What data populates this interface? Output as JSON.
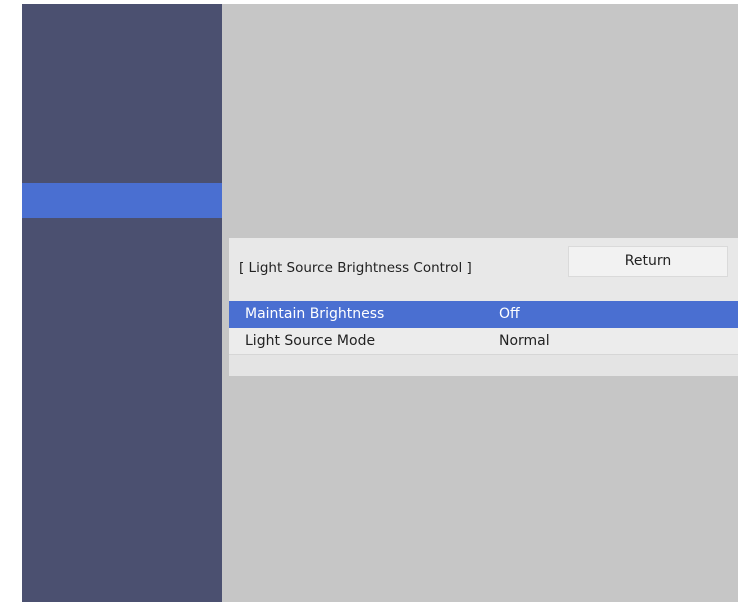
{
  "menu": {
    "title": "[ Light Source Brightness Control ]",
    "return_label": "Return",
    "items": [
      {
        "label": "Maintain Brightness",
        "value": "Off",
        "selected": true
      },
      {
        "label": "Light Source Mode",
        "value": "Normal",
        "selected": false
      }
    ]
  },
  "colors": {
    "sidebar": "#4b5070",
    "highlight": "#4a6fd1",
    "background": "#c6c6c6",
    "panel": "#e8e8e8"
  }
}
